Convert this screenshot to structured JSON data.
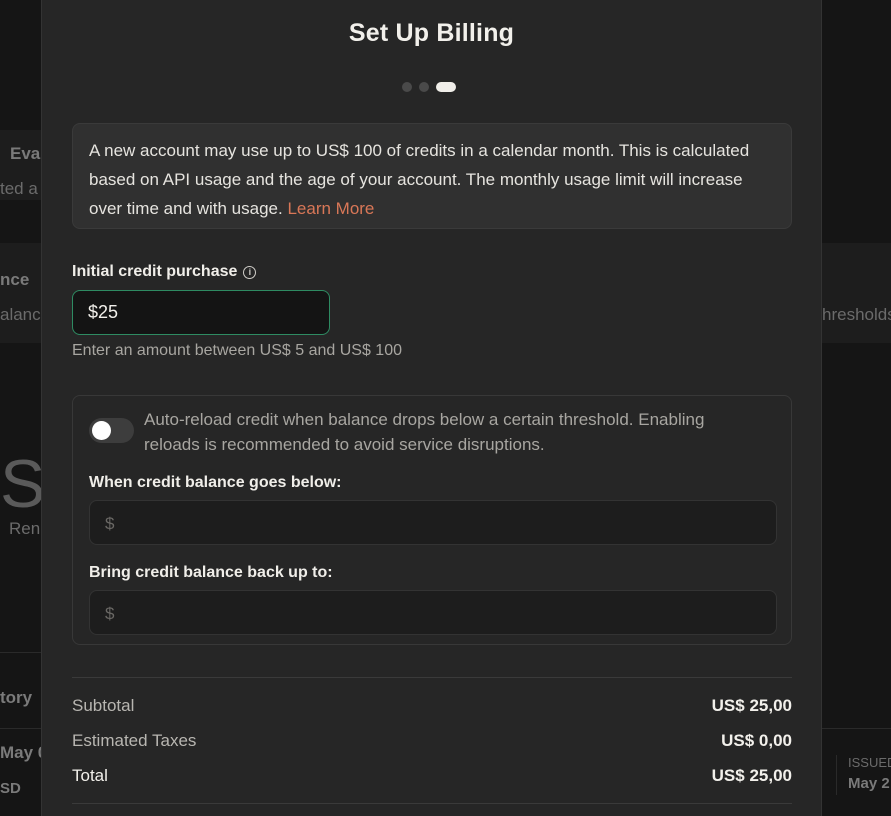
{
  "background": {
    "fragments": [
      "Eval",
      "ted a",
      "nce",
      "alance",
      "hresholds",
      "S",
      "Ren",
      "tory",
      "May 0",
      "SD",
      "ISSUED",
      "May 2"
    ]
  },
  "modal": {
    "title": "Set Up Billing",
    "step_indicator": {
      "current_step": 3,
      "total_steps": 3
    },
    "notice": {
      "text": "A new account may use up to US$ 100 of credits in a calendar month. This is calculated based on API usage and the age of your account. The monthly usage limit will increase over time and with usage.",
      "link": "Learn More"
    },
    "credit_purchase": {
      "label": "Initial credit purchase",
      "info_icon": "info-icon",
      "value": "$25",
      "helper": "Enter an amount between US$ 5 and US$ 100"
    },
    "auto_reload": {
      "enabled": false,
      "description": "Auto-reload credit when balance drops below a certain threshold. Enabling reloads is recommended to avoid service disruptions.",
      "below_label": "When credit balance goes below:",
      "below_placeholder": "$",
      "backup_label": "Bring credit balance back up to:",
      "backup_placeholder": "$"
    },
    "summary": {
      "subtotal_label": "Subtotal",
      "subtotal_value": "US$ 25,00",
      "taxes_label": "Estimated Taxes",
      "taxes_value": "US$ 0,00",
      "total_label": "Total",
      "total_value": "US$ 25,00"
    },
    "colors": {
      "accent_link": "#d97757",
      "input_focus": "#2e8b62",
      "modal_bg": "#262626"
    }
  }
}
